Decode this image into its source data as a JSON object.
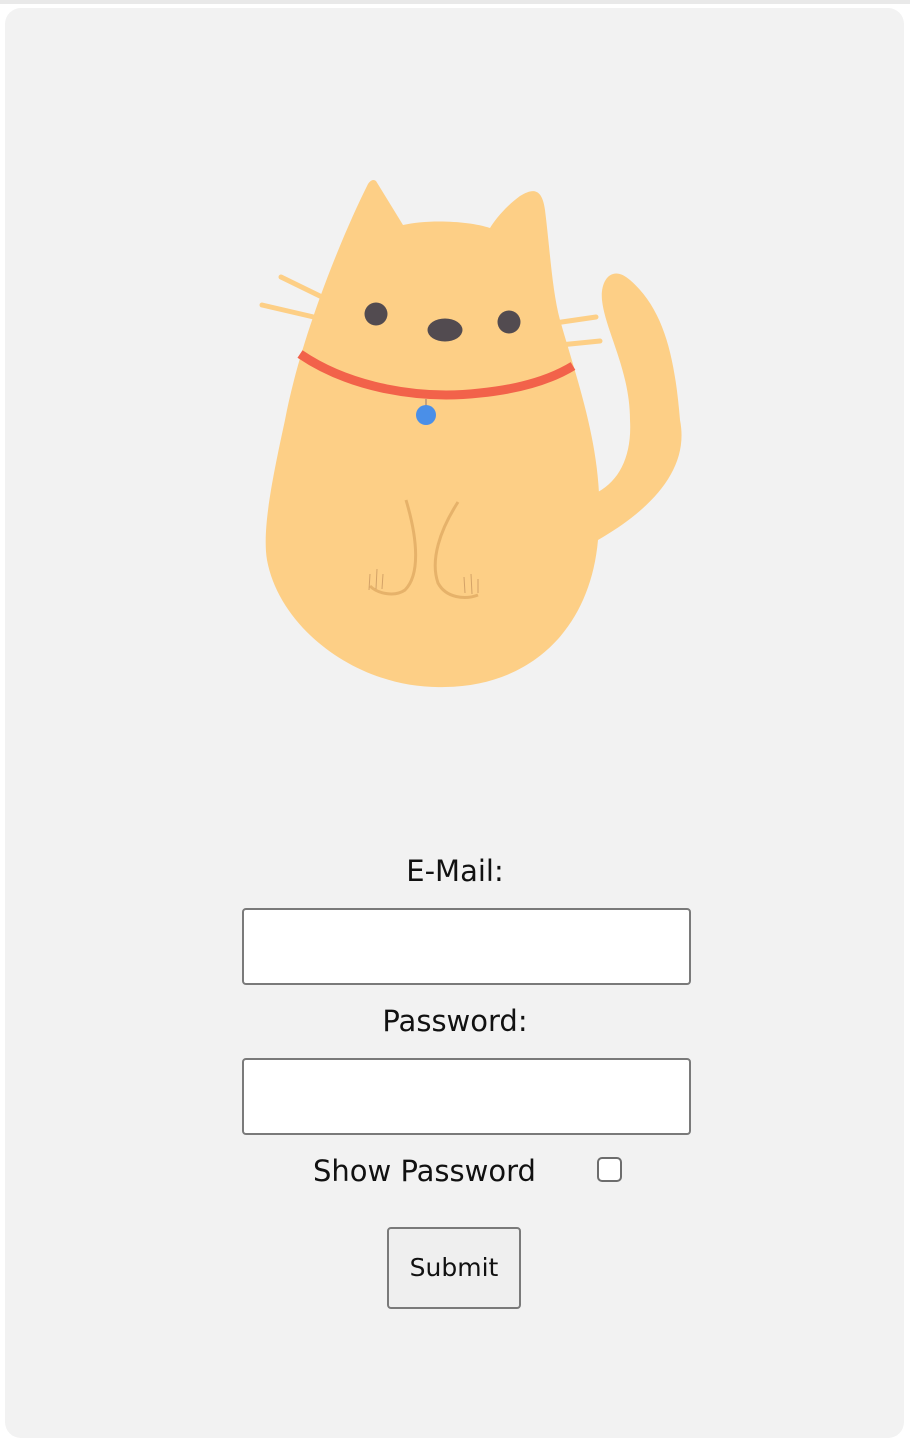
{
  "illustration": {
    "name": "cat",
    "colors": {
      "body": "#fdcf86",
      "collar": "#f2624a",
      "tag": "#4a8fe8",
      "eyes": "#524b50",
      "paw_lines": "#e6b26a"
    }
  },
  "form": {
    "email_label": "E-Mail:",
    "email_value": "",
    "password_label": "Password:",
    "password_value": "",
    "show_password_label": "Show Password",
    "show_password_checked": false,
    "submit_label": "Submit"
  },
  "colors": {
    "card_background": "#f2f2f2",
    "input_border": "#7a7a7a",
    "text": "#111111"
  }
}
